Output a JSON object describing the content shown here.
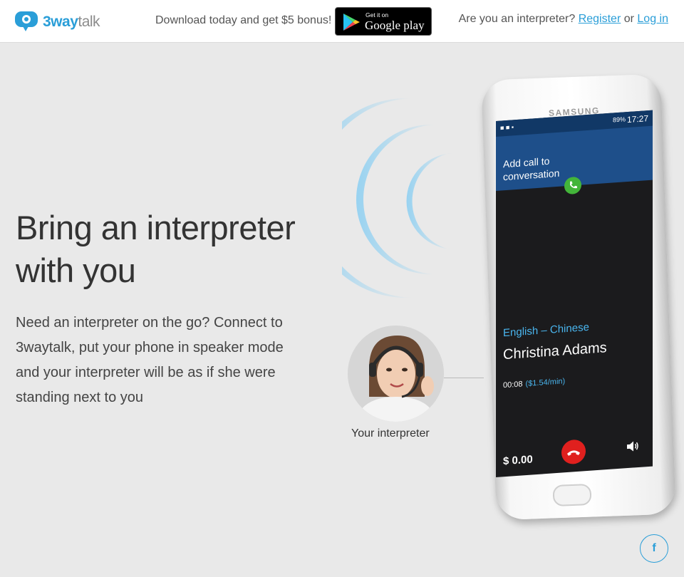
{
  "header": {
    "logo_primary": "3way",
    "logo_secondary": "talk",
    "promo": "Download today and get $5 bonus!",
    "gplay_small": "Get it on",
    "gplay_big": "Google play",
    "interpreter_question": "Are you an interpreter?",
    "register": "Register",
    "or": "or",
    "login": "Log in"
  },
  "hero": {
    "headline_line1": "Bring an interpreter",
    "headline_line2": "with you",
    "description": "Need an interpreter on the go? Connect to 3waytalk, put your phone in speaker mode and your interpreter will be as if she were standing next to you"
  },
  "interpreter": {
    "label": "Your interpreter"
  },
  "phone": {
    "brand": "SAMSUNG",
    "status_time": "17:27",
    "battery": "89%",
    "add_call": "Add call to conversation",
    "language_pair": "English – Chinese",
    "contact_name": "Christina Adams",
    "duration": "00:08",
    "rate": "($1.54/min)",
    "balance": "$ 0.00"
  },
  "social": {
    "facebook": "f"
  },
  "colors": {
    "accent": "#2a9ed8",
    "call_green": "#43b53a",
    "hangup_red": "#e0201e",
    "screen_blue": "#1e4f8a"
  }
}
